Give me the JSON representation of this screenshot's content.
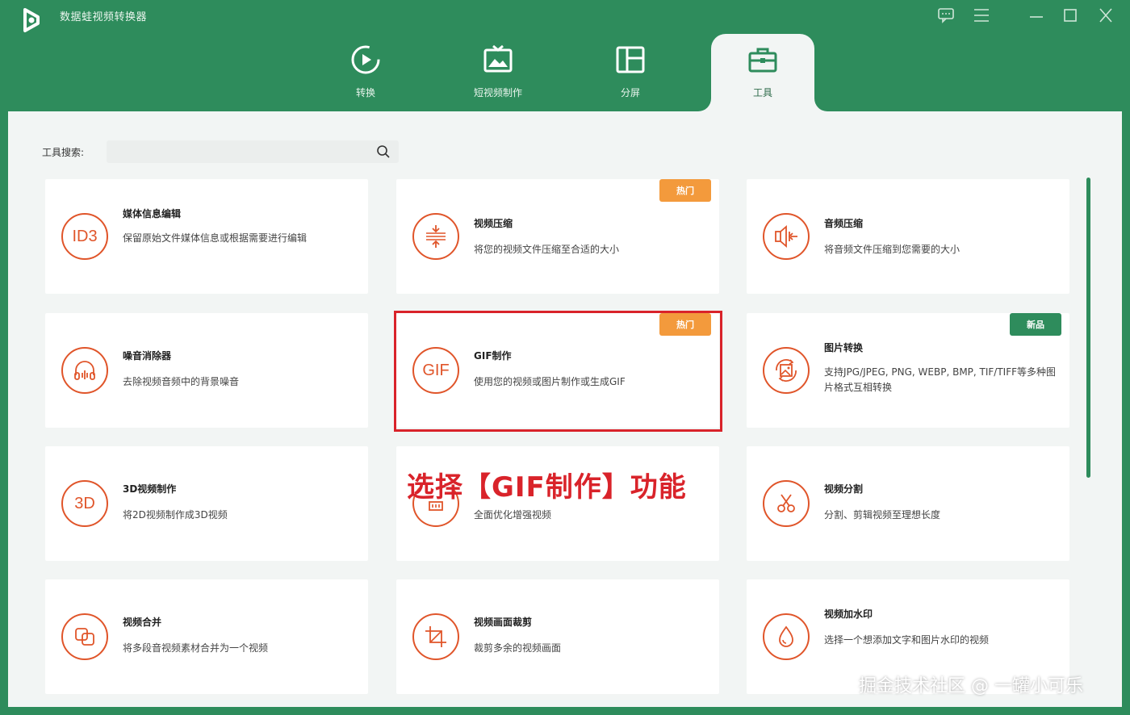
{
  "app": {
    "title": "数据蛙视频转换器"
  },
  "tabs": [
    {
      "label": "转换",
      "icon": "convert-icon",
      "active": false
    },
    {
      "label": "短视频制作",
      "icon": "short-video-icon",
      "active": false
    },
    {
      "label": "分屏",
      "icon": "split-screen-icon",
      "active": false
    },
    {
      "label": "工具",
      "icon": "toolbox-icon",
      "active": true
    }
  ],
  "search": {
    "label": "工具搜索:",
    "placeholder": "",
    "value": ""
  },
  "cards": [
    {
      "icon_text": "ID3",
      "title": "媒体信息编辑",
      "desc": "保留原始文件媒体信息或根据需要进行编辑",
      "badge": ""
    },
    {
      "icon_text": "",
      "icon": "compress-icon",
      "title": "视频压缩",
      "desc": "将您的视频文件压缩至合适的大小",
      "badge": "热门"
    },
    {
      "icon_text": "",
      "icon": "audio-compress-icon",
      "title": "音频压缩",
      "desc": "将音频文件压缩到您需要的大小",
      "badge": ""
    },
    {
      "icon_text": "",
      "icon": "headphones-icon",
      "title": "噪音消除器",
      "desc": "去除视频音频中的背景噪音",
      "badge": ""
    },
    {
      "icon_text": "GIF",
      "title": "GIF制作",
      "desc": "使用您的视频或图片制作或生成GIF",
      "badge": "热门"
    },
    {
      "icon_text": "",
      "icon": "image-convert-icon",
      "title": "图片转换",
      "desc": "支持JPG/JPEG, PNG, WEBP, BMP, TIF/TIFF等多种图片格式互相转换",
      "badge": "新品"
    },
    {
      "icon_text": "3D",
      "title": "3D视频制作",
      "desc": "将2D视频制作成3D视频",
      "badge": ""
    },
    {
      "icon_text": "",
      "icon": "enhance-icon",
      "title": "",
      "desc": "全面优化增强视频",
      "badge": ""
    },
    {
      "icon_text": "",
      "icon": "scissors-icon",
      "title": "视频分割",
      "desc": "分割、剪辑视频至理想长度",
      "badge": ""
    },
    {
      "icon_text": "",
      "icon": "merge-icon",
      "title": "视频合并",
      "desc": "将多段音视频素材合并为一个视频",
      "badge": ""
    },
    {
      "icon_text": "",
      "icon": "crop-icon",
      "title": "视频画面裁剪",
      "desc": "裁剪多余的视频画面",
      "badge": ""
    },
    {
      "icon_text": "",
      "icon": "watermark-drop-icon",
      "title": "视频加水印",
      "desc": "选择一个想添加文字和图片水印的视频",
      "badge": ""
    }
  ],
  "annotation": "选择【GIF制作】功能",
  "watermark": "掘金技术社区 @ 一罐小可乐",
  "colors": {
    "brand_green": "#2e8c5c",
    "accent_orange": "#e0552a",
    "hot_badge": "#f39a3c",
    "highlight_red": "#d9232a"
  }
}
